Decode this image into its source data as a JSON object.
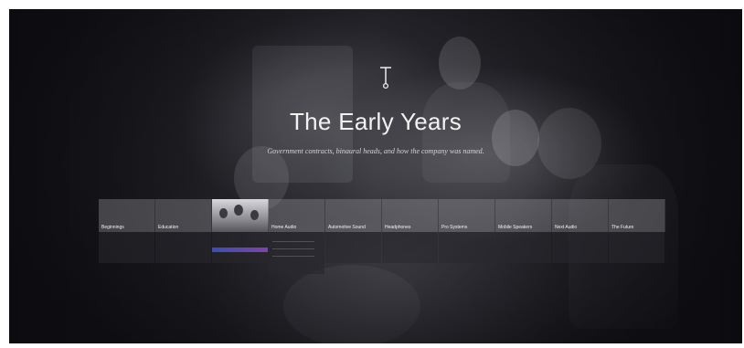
{
  "hero": {
    "title": "The Early Years",
    "subtitle": "Government contracts, binaural heads, and how the company was named.",
    "icon": "timeline-pin-icon"
  },
  "nav": {
    "items": [
      {
        "label": "Beginnings",
        "active": false
      },
      {
        "label": "Education",
        "active": false
      },
      {
        "label": "",
        "active": true
      },
      {
        "label": "Home Audio",
        "active": false
      },
      {
        "label": "Automotive Sound",
        "active": false
      },
      {
        "label": "Headphones",
        "active": false
      },
      {
        "label": "Pro Systems",
        "active": false
      },
      {
        "label": "Mobile Speakers",
        "active": false
      },
      {
        "label": "Next Audio",
        "active": false
      },
      {
        "label": "The Future",
        "active": false
      }
    ]
  },
  "colors": {
    "accent_start": "#3b4fb3",
    "accent_end": "#7f43a9",
    "title": "#f2f2f2",
    "background": "#1e1e23"
  }
}
